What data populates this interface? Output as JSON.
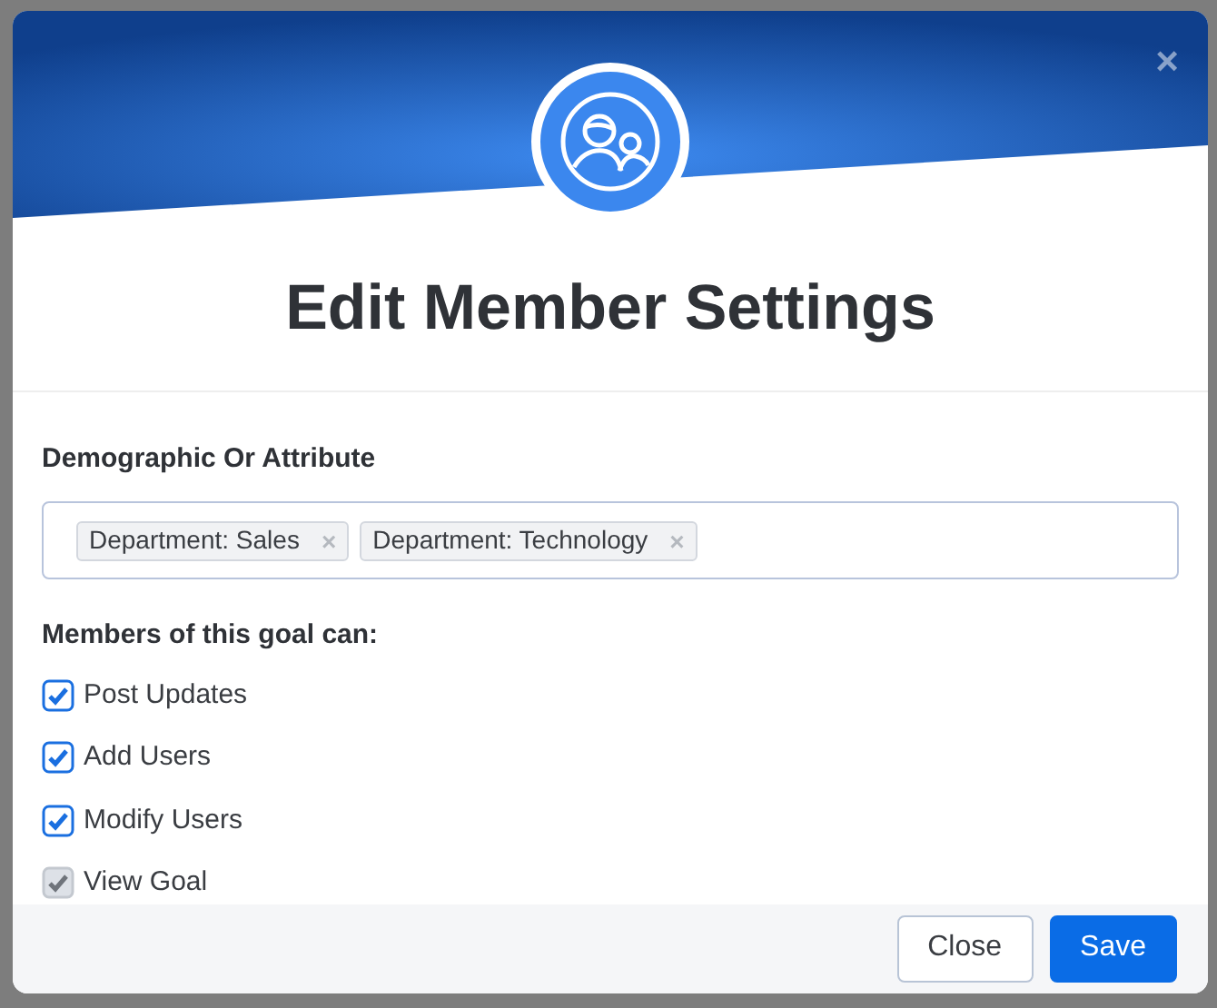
{
  "dialog": {
    "title": "Edit Member Settings",
    "close_label": "×"
  },
  "attribute_field": {
    "label": "Demographic Or Attribute",
    "tags": [
      {
        "label": "Department: Sales",
        "remove": "×"
      },
      {
        "label": "Department: Technology",
        "remove": "×"
      }
    ]
  },
  "permissions": {
    "label": "Members of this goal can:",
    "items": [
      {
        "label": "Post Updates",
        "checked": true,
        "disabled": false
      },
      {
        "label": "Add Users",
        "checked": true,
        "disabled": false
      },
      {
        "label": "Modify Users",
        "checked": true,
        "disabled": false
      },
      {
        "label": "View Goal",
        "checked": true,
        "disabled": true
      }
    ]
  },
  "buttons": [
    {
      "label": "Close",
      "kind": "secondary"
    },
    {
      "label": "Save",
      "kind": "primary"
    }
  ]
}
